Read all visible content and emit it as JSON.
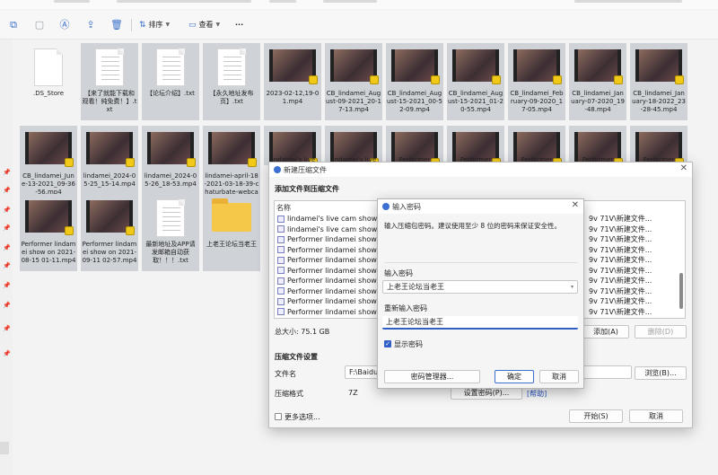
{
  "toolbar": {
    "sort_label": "排序",
    "view_label": "查看",
    "more_label": "···"
  },
  "files": [
    {
      "name": ".DS_Store",
      "kind": "doc"
    },
    {
      "name": "【来了就能下载和观看！纯免费！】.txt",
      "kind": "doc"
    },
    {
      "name": "【论坛介绍】.txt",
      "kind": "doc"
    },
    {
      "name": "【永久地址发布页】.txt",
      "kind": "doc"
    },
    {
      "name": "2023-02-12,19-01.mp4",
      "kind": "video"
    },
    {
      "name": "CB_lindamei_August-09-2021_20-17-13.mp4",
      "kind": "video"
    },
    {
      "name": "CB_lindamei_August-15-2021_00-52-09.mp4",
      "kind": "video"
    },
    {
      "name": "CB_lindamei_August-15-2021_01-20-55.mp4",
      "kind": "video"
    },
    {
      "name": "CB_lindamei_February-09-2020_17-05.mp4",
      "kind": "video"
    },
    {
      "name": "CB_lindamei_January-07-2020_19-48.mp4",
      "kind": "video"
    },
    {
      "name": "CB_lindamei_January-18-2022_23-28-45.mp4",
      "kind": "video"
    },
    {
      "name": "CB_lindamei_June-13-2021_09-36-56.mp4",
      "kind": "video"
    },
    {
      "name": "lindamei_2024-05-25_15-14.mp4",
      "kind": "video"
    },
    {
      "name": "lindamei_2024-05-26_18-53.mp4",
      "kind": "video"
    },
    {
      "name": "lindamei-april-18-2021-03-18-39-chaturbate-webcam_108...",
      "kind": "video"
    },
    {
      "name": "lindamei's live",
      "kind": "video"
    },
    {
      "name": "lindamei's live",
      "kind": "video"
    },
    {
      "name": "Performer",
      "kind": "video"
    },
    {
      "name": "Performer",
      "kind": "video"
    },
    {
      "name": "Performer",
      "kind": "video"
    },
    {
      "name": "Performer",
      "kind": "video"
    },
    {
      "name": "Performer",
      "kind": "video"
    },
    {
      "name": "Performer lindamei show on 2021-08-15 01-11.mp4",
      "kind": "video"
    },
    {
      "name": "Performer lindamei show on 2021-09-11 02-57.mp4",
      "kind": "video"
    },
    {
      "name": "最新地址及APP请发邮箱自动获取！！！.txt",
      "kind": "doc"
    },
    {
      "name": "上老王论坛当老王",
      "kind": "folder"
    }
  ],
  "compress_dialog": {
    "title": "新建压缩文件",
    "add_section": "添加文件到压缩文件",
    "col_name": "名称",
    "rows": [
      {
        "name": "lindamei's live cam show re",
        "path": "9v 71V\\新建文件..."
      },
      {
        "name": "lindamei's live cam show re",
        "path": "9v 71V\\新建文件..."
      },
      {
        "name": "Performer lindamei show or",
        "path": "9v 71V\\新建文件..."
      },
      {
        "name": "Performer lindamei show or",
        "path": "9v 71V\\新建文件..."
      },
      {
        "name": "Performer lindamei show or",
        "path": "9v 71V\\新建文件..."
      },
      {
        "name": "Performer lindamei show or",
        "path": "9v 71V\\新建文件..."
      },
      {
        "name": "Performer lindamei show or",
        "path": "9v 71V\\新建文件..."
      },
      {
        "name": "Performer lindamei show or",
        "path": "9v 71V\\新建文件..."
      },
      {
        "name": "Performer lindamei show or",
        "path": "9v 71V\\新建文件..."
      },
      {
        "name": "Performer lindamei show or",
        "path": "9v 71V\\新建文件..."
      },
      {
        "name": "最新地址及APP请发邮箱自动获",
        "path": "9v 71V\\新建文件..."
      }
    ],
    "total_size": "总大小: 75.1 GB",
    "add_button": "添加(A)",
    "delete_button": "删除(D)",
    "settings_section": "压缩文件设置",
    "filename_label": "文件名",
    "filename_value": "F:\\BaiduN",
    "browse_button": "浏览(B)...",
    "format_label": "压缩格式",
    "format_value": "7Z",
    "set_password_button": "设置密码(P)...",
    "help_link": "[帮助]",
    "more_options": "更多选项...",
    "start_button": "开始(S)",
    "cancel_button": "取消"
  },
  "password_dialog": {
    "title": "输入密码",
    "hint": "输入压缩包密码。建议使用至少 8 位的密码来保证安全性。",
    "password_label": "输入密码",
    "password_value": "上老王论坛当老王",
    "repeat_label": "重新输入密码",
    "repeat_value": "上老王论坛当老王",
    "show_password": "显示密码",
    "manager_button": "密码管理器...",
    "ok_button": "确定",
    "cancel_button": "取消"
  }
}
